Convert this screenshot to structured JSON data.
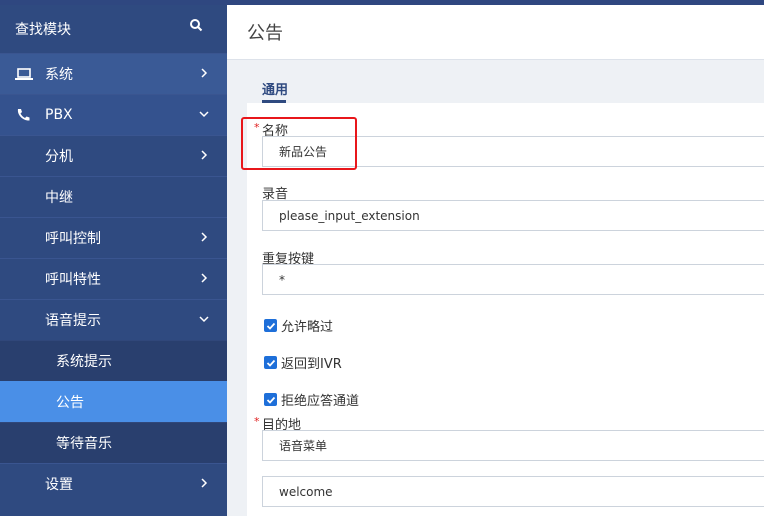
{
  "sidebar": {
    "search_label": "查找模块",
    "items": [
      {
        "label": "系统"
      },
      {
        "label": "PBX"
      },
      {
        "label": "分机"
      },
      {
        "label": "中继"
      },
      {
        "label": "呼叫控制"
      },
      {
        "label": "呼叫特性"
      },
      {
        "label": "语音提示"
      },
      {
        "label": "系统提示"
      },
      {
        "label": "公告"
      },
      {
        "label": "等待音乐"
      },
      {
        "label": "设置"
      }
    ]
  },
  "header": {
    "title": "公告"
  },
  "tabs": [
    {
      "label": "通用"
    }
  ],
  "form": {
    "name_label": "名称",
    "name_value": "新品公告",
    "recording_label": "录音",
    "recording_value": "please_input_extension",
    "repeat_key_label": "重复按键",
    "repeat_key_value": "*",
    "allow_skip_label": "允许略过",
    "return_ivr_label": "返回到IVR",
    "reject_channel_label": "拒绝应答通道",
    "destination_label": "目的地",
    "destination_type": "语音菜单",
    "destination_value": "welcome",
    "required_mark": "*"
  },
  "colors": {
    "sidebar_bg": "#2f4a80",
    "active_item": "#4a8fe7",
    "highlight_box": "#e8161b",
    "checkbox": "#1e6fd9"
  }
}
